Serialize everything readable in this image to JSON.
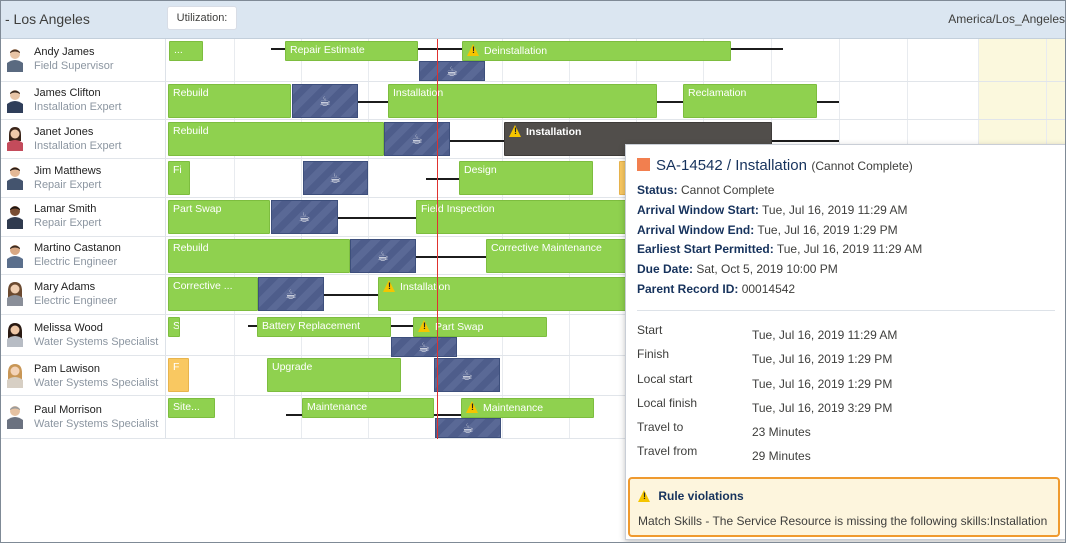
{
  "header": {
    "title": "- Los Angeles",
    "utilization_label": "Utilization:",
    "timezone": "America/Los_Angeles"
  },
  "resources": [
    {
      "name": "Andy James",
      "role": "Field Supervisor"
    },
    {
      "name": "James Clifton",
      "role": "Installation Expert"
    },
    {
      "name": "Janet Jones",
      "role": "Installation Expert"
    },
    {
      "name": "Jim Matthews",
      "role": "Repair Expert"
    },
    {
      "name": "Lamar Smith",
      "role": "Repair Expert"
    },
    {
      "name": "Martino Castanon",
      "role": "Electric Engineer"
    },
    {
      "name": "Mary Adams",
      "role": "Electric Engineer"
    },
    {
      "name": "Melissa Wood",
      "role": "Water Systems Specialist"
    },
    {
      "name": "Pam Lawison",
      "role": "Water Systems Specialist"
    },
    {
      "name": "Paul Morrison",
      "role": "Water Systems Specialist"
    }
  ],
  "gantt": {
    "break_icon": "coffee-cup-icon",
    "warning_icon": "warning-triangle-icon",
    "labels": {
      "andy_1": "...",
      "andy_2": "Repair Estimate",
      "andy_3": "Deinstallation",
      "james_1": "Rebuild",
      "james_2": "Installation",
      "james_3": "Reclamation",
      "janet_1": "Rebuild",
      "janet_2": "Installation",
      "jim_1": "Fi",
      "jim_2": "Design",
      "lamar_1": "Part Swap",
      "lamar_2": "Field Inspection",
      "martino_1": "Rebuild",
      "martino_2": "Corrective Maintenance",
      "mary_1": "Corrective ...",
      "mary_2": "Installation",
      "melissa_1": "S",
      "melissa_2": "Battery Replacement",
      "melissa_3": "Part Swap",
      "pam_1": "F",
      "pam_2": "Upgrade",
      "paul_1": "Site...",
      "paul_2": "Maintenance",
      "paul_3": "Maintenance"
    }
  },
  "popover": {
    "title": "SA-14542 / Installation",
    "subtitle": "(Cannot Complete)",
    "status_color": "#f27f4f",
    "fields": [
      {
        "label": "Status:",
        "value": "Cannot Complete"
      },
      {
        "label": "Arrival Window Start:",
        "value": "Tue, Jul 16, 2019 11:29 AM"
      },
      {
        "label": "Arrival Window End:",
        "value": "Tue, Jul 16, 2019 1:29 PM"
      },
      {
        "label": "Earliest Start Permitted:",
        "value": "Tue, Jul 16, 2019 11:29 AM"
      },
      {
        "label": "Due Date:",
        "value": "Sat, Oct 5, 2019 10:00 PM"
      },
      {
        "label": "Parent Record ID:",
        "value": "00014542"
      }
    ],
    "times": [
      {
        "label": "Start",
        "value": "Tue, Jul 16, 2019 11:29 AM"
      },
      {
        "label": "Finish",
        "value": "Tue, Jul 16, 2019 1:29 PM"
      },
      {
        "label": "Local start",
        "value": "Tue, Jul 16, 2019 1:29 PM"
      },
      {
        "label": "Local finish",
        "value": "Tue, Jul 16, 2019 3:29 PM"
      },
      {
        "label": "Travel to",
        "value": "23 Minutes"
      },
      {
        "label": "Travel from",
        "value": "29 Minutes"
      }
    ],
    "violations": {
      "title": "Rule violations",
      "text": "Match Skills - The Service Resource is missing the following skills:Installation",
      "border_color": "#ef9a2f"
    }
  }
}
